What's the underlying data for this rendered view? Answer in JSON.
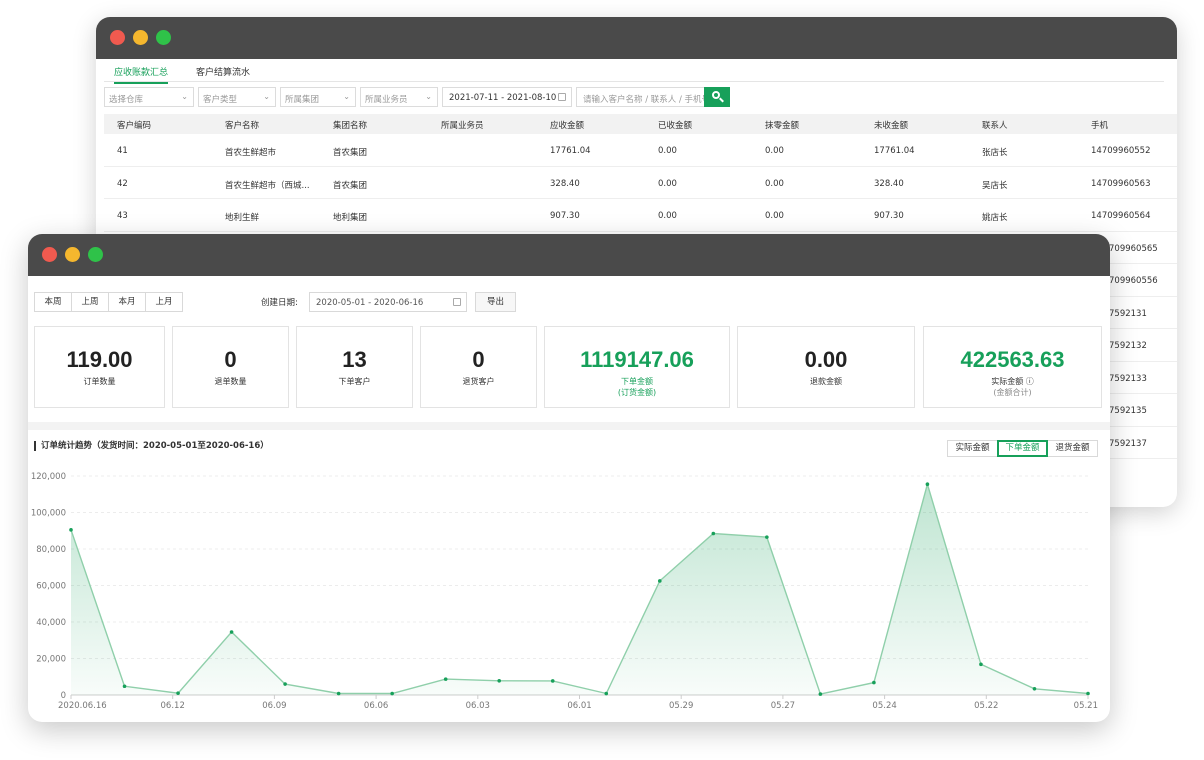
{
  "back_window": {
    "tabs": [
      {
        "label": "应收账款汇总",
        "active": true
      },
      {
        "label": "客户结算流水",
        "active": false
      }
    ],
    "filters": {
      "warehouse_placeholder": "选择仓库",
      "customer_type_placeholder": "客户类型",
      "group_placeholder": "所属集团",
      "salesman_placeholder": "所属业务员",
      "date_range": "2021-07-11 - 2021-08-10",
      "search_placeholder": "请输入客户名称 / 联系人 / 手机号"
    },
    "table": {
      "headers": [
        "客户编码",
        "客户名称",
        "集团名称",
        "所属业务员",
        "应收金额",
        "已收金额",
        "抹零金额",
        "未收金额",
        "联系人",
        "手机"
      ],
      "rows": [
        [
          "41",
          "首农生鲜超市",
          "首农集团",
          "",
          "17761.04",
          "0.00",
          "0.00",
          "17761.04",
          "张店长",
          "14709960552"
        ],
        [
          "42",
          "首农生鲜超市（西城...",
          "首农集团",
          "",
          "328.40",
          "0.00",
          "0.00",
          "328.40",
          "吴店长",
          "14709960563"
        ],
        [
          "43",
          "地利生鲜",
          "地利集团",
          "",
          "907.30",
          "0.00",
          "0.00",
          "907.30",
          "姚店长",
          "14709960564"
        ]
      ],
      "hidden_phone_tails": [
        "709960565",
        "709960556",
        "7592131",
        "7592132",
        "7592133",
        "7592135",
        "7592137"
      ]
    }
  },
  "front_window": {
    "period_buttons": [
      "本周",
      "上周",
      "本月",
      "上月"
    ],
    "date_label": "创建日期:",
    "date_range": "2020-05-01 - 2020-06-16",
    "export_label": "导出",
    "cards": [
      {
        "value": "119.00",
        "label": "订单数量",
        "sub": "",
        "green": false
      },
      {
        "value": "0",
        "label": "退单数量",
        "sub": "",
        "green": false
      },
      {
        "value": "13",
        "label": "下单客户",
        "sub": "",
        "green": false
      },
      {
        "value": "0",
        "label": "退货客户",
        "sub": "",
        "green": false
      },
      {
        "value": "1119147.06",
        "label": "下单金额",
        "sub": "(订货金额)",
        "green": true
      },
      {
        "value": "0.00",
        "label": "退款金额",
        "sub": "",
        "green": false
      },
      {
        "value": "422563.63",
        "label": "实际金额 ⓘ",
        "sub": "(金额合计)",
        "green": true
      }
    ],
    "chart_title": "订单统计趋势（发货时间：2020-05-01至2020-06-16）",
    "toggles": [
      {
        "label": "实际金额",
        "active": false
      },
      {
        "label": "下单金额",
        "active": true
      },
      {
        "label": "退货金额",
        "active": false
      }
    ],
    "accent_color": "#17a05a"
  },
  "chart_data": {
    "type": "area",
    "x_tick_labels": [
      "2020.06.16",
      "06.12",
      "06.09",
      "06.06",
      "06.03",
      "06.01",
      "05.29",
      "05.27",
      "05.24",
      "05.22",
      "05.21"
    ],
    "y_tick_labels": [
      "0",
      "20,000",
      "40,000",
      "60,000",
      "80,000",
      "100,000",
      "120,000"
    ],
    "ylim": [
      0,
      120000
    ],
    "values": [
      90500,
      4800,
      1000,
      34500,
      6000,
      800,
      800,
      8700,
      7800,
      7700,
      800,
      62500,
      88500,
      86500,
      500,
      6800,
      115500,
      16800,
      3400,
      800
    ],
    "grid": true,
    "legend": "none",
    "line_color": "#8fcfaa",
    "fill_color": "#17a05a"
  }
}
